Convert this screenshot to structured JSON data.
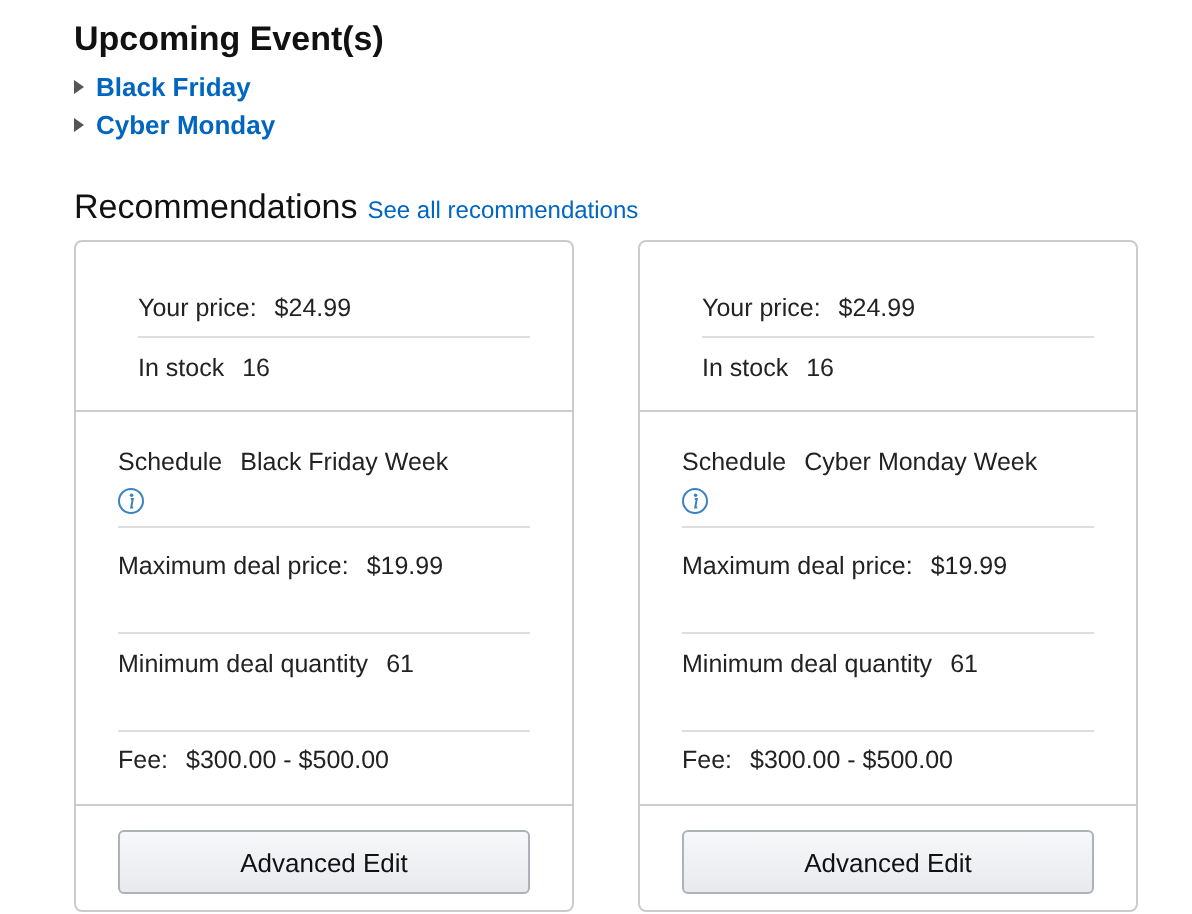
{
  "upcoming": {
    "title": "Upcoming Event(s)",
    "events": [
      {
        "label": "Black Friday",
        "expanded": false
      },
      {
        "label": "Cyber Monday",
        "expanded": false
      }
    ]
  },
  "recommendations": {
    "title": "Recommendations",
    "see_all": "See all recommendations",
    "cards": [
      {
        "price_label": "Your price:",
        "price": "$24.99",
        "stock_label": "In stock",
        "stock": "16",
        "schedule_label": "Schedule",
        "schedule": "Black Friday Week",
        "max_label": "Maximum deal price:",
        "max": "$19.99",
        "min_label": "Minimum deal quantity",
        "min": "61",
        "fee_label": "Fee:",
        "fee": "$300.00 - $500.00",
        "button": "Advanced Edit"
      },
      {
        "price_label": "Your price:",
        "price": "$24.99",
        "stock_label": "In stock",
        "stock": "16",
        "schedule_label": "Schedule",
        "schedule": "Cyber Monday Week",
        "max_label": "Maximum deal price:",
        "max": "$19.99",
        "min_label": "Minimum deal quantity",
        "min": "61",
        "fee_label": "Fee:",
        "fee": "$300.00 - $500.00",
        "button": "Advanced Edit"
      }
    ]
  }
}
